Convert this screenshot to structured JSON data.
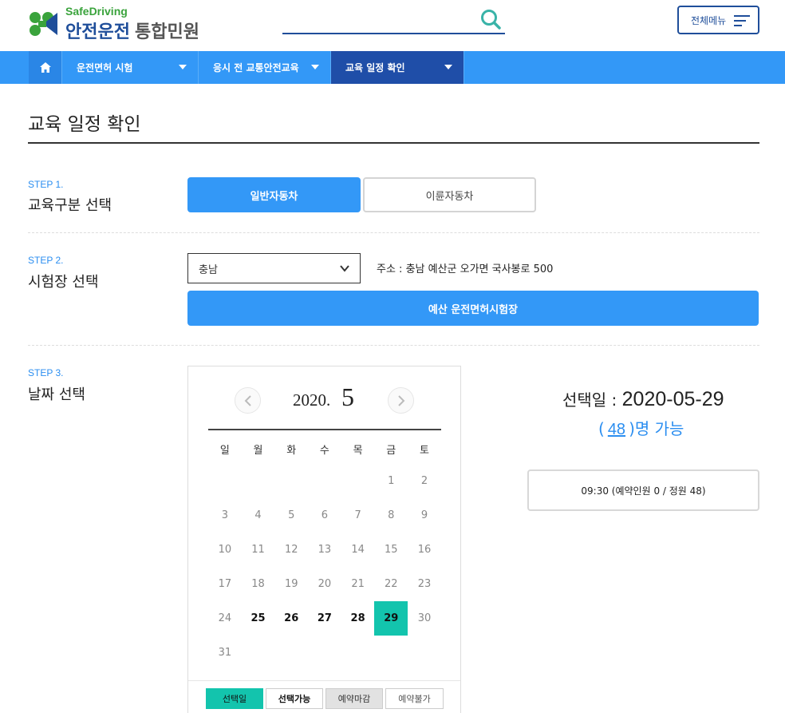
{
  "header": {
    "logo_sub": "SafeDriving",
    "logo_main": "안전운전",
    "logo_main_gray": "통합민원",
    "menu_label": "전체메뉴"
  },
  "nav": {
    "items": [
      {
        "label": "운전면허 시험"
      },
      {
        "label": "응시 전 교통안전교육"
      },
      {
        "label": "교육 일정 확인",
        "active": true
      }
    ]
  },
  "page": {
    "title": "교육 일정 확인"
  },
  "step1": {
    "step": "STEP 1.",
    "title": "교육구분 선택",
    "options": [
      "일반자동차",
      "이륜자동차"
    ],
    "selected": "일반자동차"
  },
  "step2": {
    "step": "STEP 2.",
    "title": "시험장 선택",
    "region_value": "충남",
    "address": "주소 : 충남 예산군 오가면 국사봉로 500",
    "center_button": "예산 운전면허시험장"
  },
  "step3": {
    "step": "STEP 3.",
    "title": "날짜 선택",
    "calendar": {
      "year": "2020.",
      "month": "5",
      "weekdays": [
        "일",
        "월",
        "화",
        "수",
        "목",
        "금",
        "토"
      ],
      "weeks": [
        [
          "",
          "",
          "",
          "",
          "",
          "1",
          "2"
        ],
        [
          "3",
          "4",
          "5",
          "6",
          "7",
          "8",
          "9"
        ],
        [
          "10",
          "11",
          "12",
          "13",
          "14",
          "15",
          "16"
        ],
        [
          "17",
          "18",
          "19",
          "20",
          "21",
          "22",
          "23"
        ],
        [
          "24",
          "25",
          "26",
          "27",
          "28",
          "29",
          "30"
        ],
        [
          "31",
          "",
          "",
          "",
          "",
          "",
          ""
        ]
      ],
      "available_days": [
        "25",
        "26",
        "27",
        "28"
      ],
      "selected_day": "29",
      "legend": [
        "선택일",
        "선택가능",
        "예약마감",
        "예약불가"
      ]
    }
  },
  "selection": {
    "date_label": "선택일 : ",
    "date_value": "2020-05-29",
    "count_open": "(",
    "count_value": "48",
    "count_close": ")명 가능",
    "slot": "09:30 (예약인원 0 / 정원 48)"
  },
  "colors": {
    "brand_blue": "#1f4e9a",
    "nav_blue": "#3398f7",
    "selected_teal": "#13c4ad",
    "logo_green": "#3aa33c"
  }
}
